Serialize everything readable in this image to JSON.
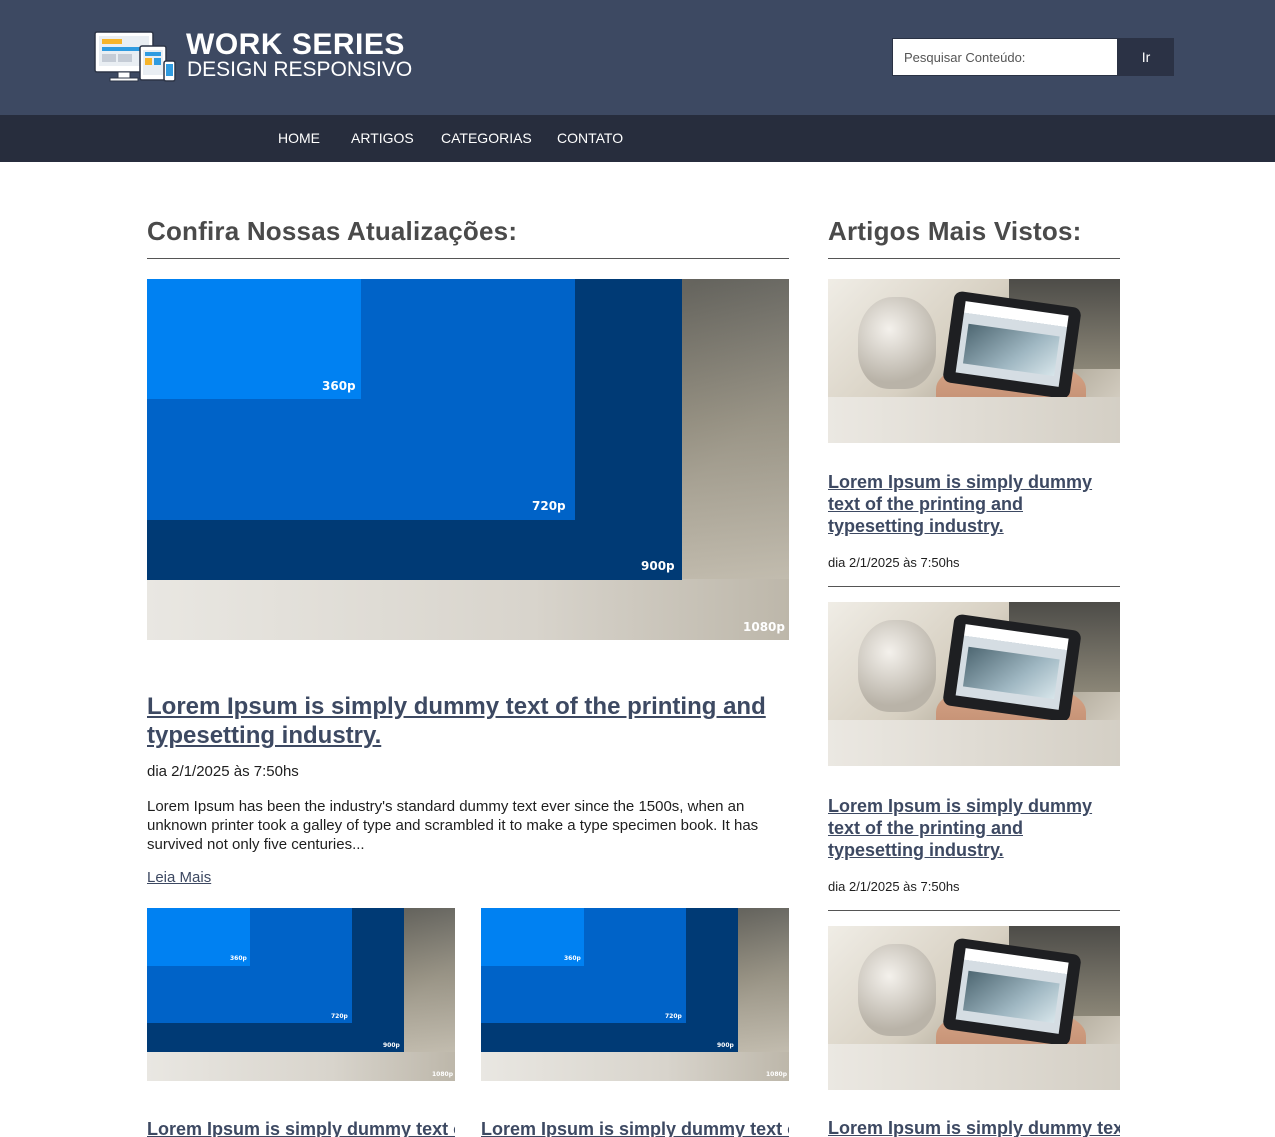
{
  "header": {
    "logo_title": "WORK SERIES",
    "logo_subtitle": "DESIGN RESPONSIVO",
    "search_placeholder": "Pesquisar Conteúdo:",
    "search_button": "Ir",
    "colors": {
      "header_bg": "#3d4962",
      "nav_bg": "#272d3d"
    }
  },
  "nav": {
    "items": [
      "HOME",
      "ARTIGOS",
      "CATEGORIAS",
      "CONTATO"
    ]
  },
  "main": {
    "section_title": "Confira Nossas Atualizações:",
    "resolution_labels": [
      "360p",
      "720p",
      "900p",
      "1080p"
    ],
    "featured": {
      "title": "Lorem Ipsum is simply dummy text of the printing and typesetting industry.",
      "date": "dia 2/1/2025 às 7:50hs",
      "excerpt": "Lorem Ipsum has been the industry's standard dummy text ever since the 1500s, when an unknown printer took a galley of type and scrambled it to make a type specimen book. It has survived not only five centuries...",
      "read_more": "Leia Mais"
    },
    "cards": [
      {
        "title": "Lorem Ipsum is simply dummy text of"
      },
      {
        "title": "Lorem Ipsum is simply dummy text of"
      }
    ]
  },
  "sidebar": {
    "section_title": "Artigos Mais Vistos:",
    "items": [
      {
        "title": "Lorem Ipsum is simply dummy text of the printing and typesetting industry.",
        "date": "dia 2/1/2025 às 7:50hs"
      },
      {
        "title": "Lorem Ipsum is simply dummy text of the printing and typesetting industry.",
        "date": "dia 2/1/2025 às 7:50hs"
      },
      {
        "title": "Lorem Ipsum is simply dummy text"
      }
    ]
  }
}
